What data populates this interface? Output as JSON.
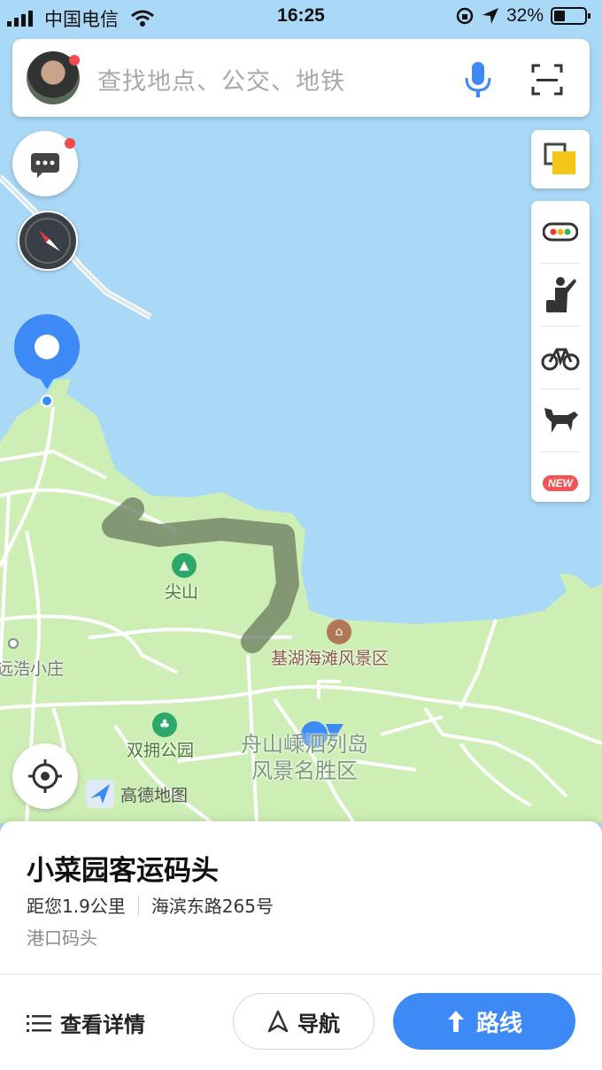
{
  "status": {
    "carrier": "中国电信",
    "time": "16:25",
    "battery": "32%"
  },
  "search": {
    "placeholder": "查找地点、公交、地铁"
  },
  "map": {
    "labels": {
      "jianshan": "尖山",
      "jihu": "基湖海滩风景区",
      "yuanhao": "远浩小庄",
      "shuangyong": "双拥公园",
      "zhoushan_line1": "舟山嵊泗列岛",
      "zhoushan_line2": "风景名胜区"
    },
    "logo_text": "高德地图",
    "colors": {
      "water": "#a9d9f7",
      "land": "#cdeeb4",
      "road": "#ffffff",
      "accent": "#3d8af7"
    }
  },
  "tools": {
    "new_badge": "NEW",
    "icons": [
      "layers-icon",
      "traffic-icon",
      "hail-taxi-icon",
      "bike-icon",
      "horse-icon"
    ]
  },
  "place": {
    "name": "小菜园客运码头",
    "distance": "距您1.9公里",
    "address": "海滨东路265号",
    "type": "港口码头"
  },
  "actions": {
    "details": "查看详情",
    "navigate": "导航",
    "route": "路线"
  }
}
